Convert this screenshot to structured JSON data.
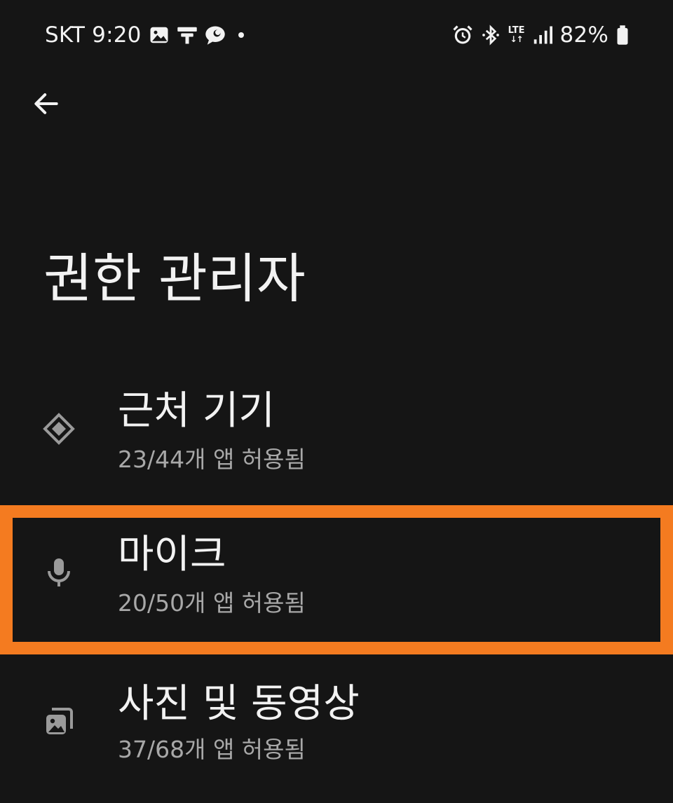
{
  "status_bar": {
    "carrier": "SKT",
    "time": "9:20",
    "network": "LTE",
    "battery": "82%",
    "left_icons": [
      "gallery-icon",
      "flag-app-icon",
      "chat-bubble-icon",
      "dot-icon"
    ],
    "right_icons": [
      "alarm-icon",
      "bluetooth-icon",
      "lte-icon",
      "signal-icon",
      "battery-icon"
    ]
  },
  "header": {
    "back_icon": "arrow-left-icon",
    "title": "권한 관리자"
  },
  "permissions": {
    "items": [
      {
        "id": "nearby",
        "icon": "nearby-devices-icon",
        "title": "근처 기기",
        "summary": "23/44개 앱 허용됨",
        "allowed": 23,
        "total": 44
      },
      {
        "id": "microphone",
        "icon": "microphone-icon",
        "title": "마이크",
        "summary": "20/50개 앱 허용됨",
        "allowed": 20,
        "total": 50,
        "highlighted": true
      },
      {
        "id": "photos_videos",
        "icon": "photos-icon",
        "title": "사진 및 동영상",
        "summary": "37/68개 앱 허용됨",
        "allowed": 37,
        "total": 68
      }
    ]
  },
  "colors": {
    "background": "#151515",
    "text_primary": "#f2f2f2",
    "text_secondary": "#a8a8a8",
    "icon_gray": "#9a9a9a",
    "highlight": "#f47b20"
  }
}
